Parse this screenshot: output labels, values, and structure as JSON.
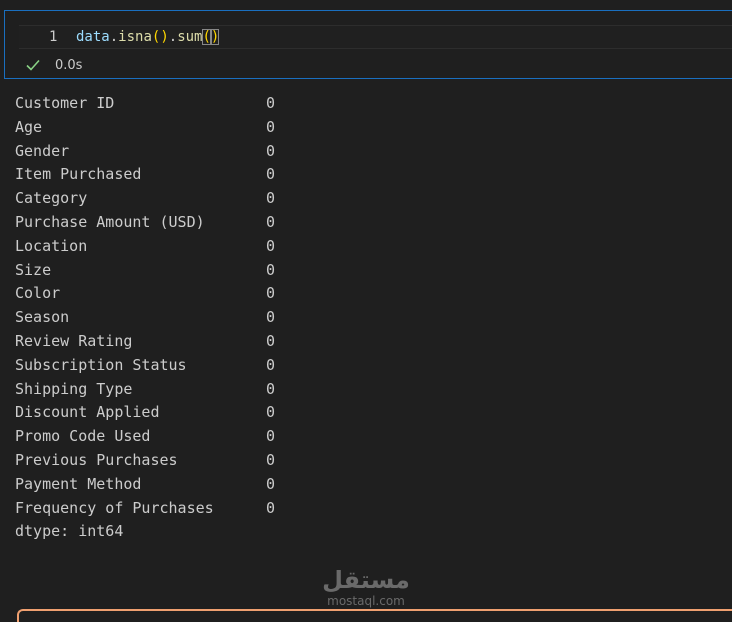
{
  "cell": {
    "line_number": "1",
    "code": {
      "var": "data",
      "dot1": ".",
      "fn1": "isna",
      "paren1_open": "(",
      "paren1_close": ")",
      "dot2": ".",
      "fn2": "sum",
      "paren2_open": "(",
      "paren2_close": ")"
    },
    "exec_time": "0.0s",
    "status_color": "#89d185"
  },
  "output": {
    "rows": [
      {
        "column": "Customer ID",
        "value": "0"
      },
      {
        "column": "Age",
        "value": "0"
      },
      {
        "column": "Gender",
        "value": "0"
      },
      {
        "column": "Item Purchased",
        "value": "0"
      },
      {
        "column": "Category",
        "value": "0"
      },
      {
        "column": "Purchase Amount (USD)",
        "value": "0"
      },
      {
        "column": "Location",
        "value": "0"
      },
      {
        "column": "Size",
        "value": "0"
      },
      {
        "column": "Color",
        "value": "0"
      },
      {
        "column": "Season",
        "value": "0"
      },
      {
        "column": "Review Rating",
        "value": "0"
      },
      {
        "column": "Subscription Status",
        "value": "0"
      },
      {
        "column": "Shipping Type",
        "value": "0"
      },
      {
        "column": "Discount Applied",
        "value": "0"
      },
      {
        "column": "Promo Code Used",
        "value": "0"
      },
      {
        "column": "Previous Purchases",
        "value": "0"
      },
      {
        "column": "Payment Method",
        "value": "0"
      },
      {
        "column": "Frequency of Purchases",
        "value": "0"
      }
    ],
    "dtype": "dtype: int64"
  },
  "watermark": {
    "logo": "مستقل",
    "url": "mostaql.com"
  },
  "colors": {
    "cell_border": "#1a6fbf",
    "next_cell_border": "#f0a070",
    "background": "#1f1f1f"
  }
}
